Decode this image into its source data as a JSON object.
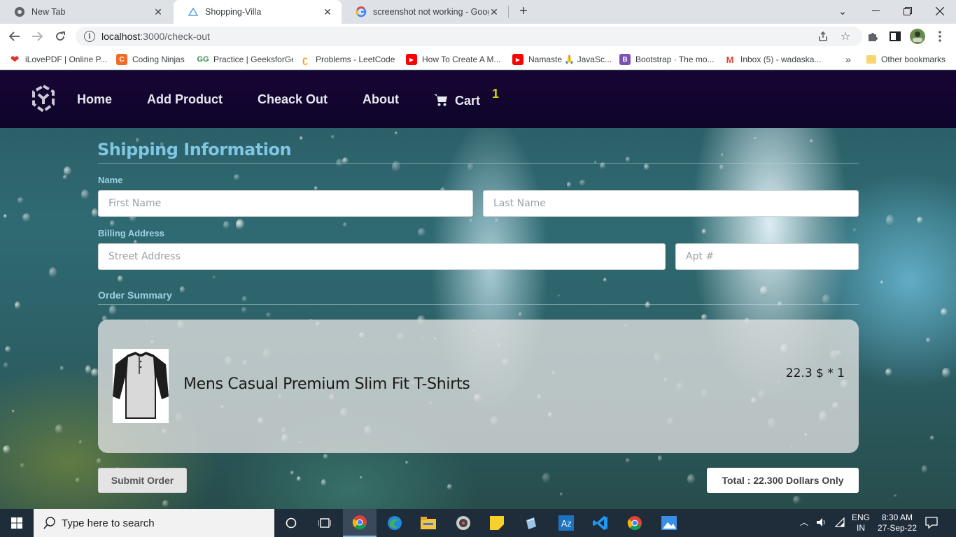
{
  "browser": {
    "tabs": [
      {
        "title": "New Tab",
        "active": false
      },
      {
        "title": "Shopping-Villa",
        "active": true
      },
      {
        "title": "screenshot not working - Google",
        "active": false
      }
    ],
    "url_host": "localhost",
    "url_rest": ":3000/check-out",
    "bookmarks": [
      {
        "label": "iLovePDF | Online P...",
        "icon": "heart-icon",
        "color": "#e5322d"
      },
      {
        "label": "Coding Ninjas",
        "icon": "coding-ninjas-icon",
        "color": "#f26a23"
      },
      {
        "label": "Practice | GeeksforGeeks",
        "icon": "gfg-icon",
        "color": "#2f8d46"
      },
      {
        "label": "Problems - LeetCode",
        "icon": "leetcode-icon",
        "color": "#f89f1b"
      },
      {
        "label": "How To Create A M...",
        "icon": "youtube-icon",
        "color": "#ff0000"
      },
      {
        "label": "Namaste 🙏 JavaSc...",
        "icon": "youtube-icon",
        "color": "#ff0000"
      },
      {
        "label": "Bootstrap · The mo...",
        "icon": "bootstrap-icon",
        "color": "#7952b3"
      },
      {
        "label": "Inbox (5) - wadaska...",
        "icon": "gmail-icon",
        "color": "#ea4335"
      }
    ],
    "bookmarks_overflow": "»",
    "other_bookmarks": "Other bookmarks"
  },
  "nav": {
    "links": [
      "Home",
      "Add Product",
      "Cheack Out",
      "About"
    ],
    "cart_label": "Cart",
    "cart_count": "1"
  },
  "form": {
    "title": "Shipping Information",
    "name_label": "Name",
    "first_name_placeholder": "First Name",
    "last_name_placeholder": "Last Name",
    "billing_label": "Billing Address",
    "street_placeholder": "Street Address",
    "apt_placeholder": "Apt #",
    "summary_label": "Order Summary"
  },
  "order": {
    "items": [
      {
        "name": "Mens Casual Premium Slim Fit T-Shirts",
        "price_text": "22.3 $ * 1"
      }
    ],
    "submit_label": "Submit Order",
    "total_text": "Total : 22.300 Dollars Only"
  },
  "taskbar": {
    "search_placeholder": "Type here to search",
    "lang_top": "ENG",
    "lang_bottom": "IN",
    "time": "8:30 AM",
    "date": "27-Sep-22"
  },
  "colors": {
    "nav_bg": "#170535",
    "heading": "#7fc6e4",
    "cart_badge": "#d6d600"
  }
}
